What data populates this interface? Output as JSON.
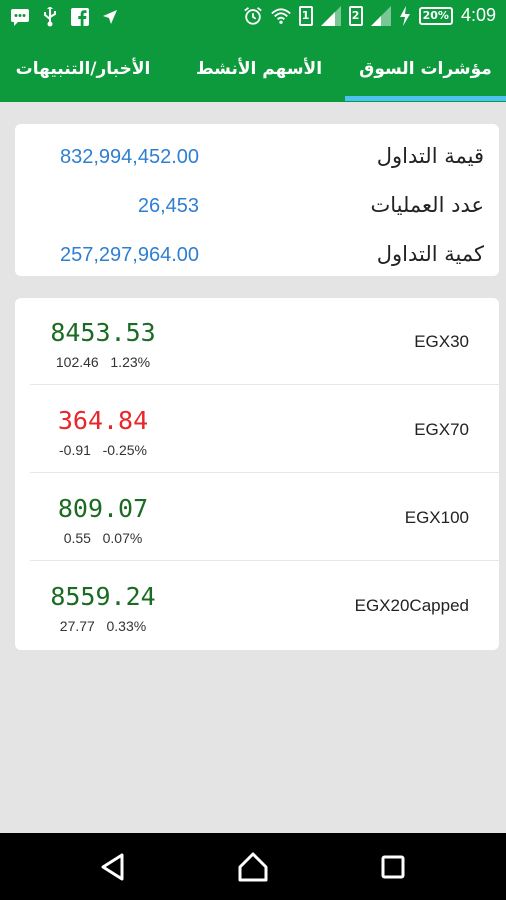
{
  "status_bar": {
    "time": "4:09",
    "battery": "20%",
    "sim1": "1",
    "sim2": "2"
  },
  "tabs": [
    {
      "label": "مؤشرات السوق",
      "active": true
    },
    {
      "label": "الأسهم الأنشط",
      "active": false
    },
    {
      "label": "الأخبار/التنبيهات",
      "active": false
    }
  ],
  "summary": [
    {
      "label": "قيمة التداول",
      "value": "832,994,452.00"
    },
    {
      "label": "عدد العمليات",
      "value": "26,453"
    },
    {
      "label": "كمية التداول",
      "value": "257,297,964.00"
    }
  ],
  "indices": [
    {
      "name": "EGX30",
      "value": "8453.53",
      "change": "102.46",
      "percent": "1.23%",
      "direction": "up"
    },
    {
      "name": "EGX70",
      "value": "364.84",
      "change": "-0.91",
      "percent": "-0.25%",
      "direction": "down"
    },
    {
      "name": "EGX100",
      "value": "809.07",
      "change": "0.55",
      "percent": "0.07%",
      "direction": "up"
    },
    {
      "name": "EGX20Capped",
      "value": "8559.24",
      "change": "27.77",
      "percent": "0.33%",
      "direction": "up"
    }
  ],
  "colors": {
    "header_green": "#0c9a3c",
    "tab_indicator": "#4cc3f2",
    "value_blue": "#2f7fd0",
    "up_green": "#1c6b22",
    "down_red": "#e8262b"
  },
  "icons": [
    "message-icon",
    "usb-icon",
    "facebook-icon",
    "arrow-icon",
    "alarm-icon",
    "wifi-icon",
    "signal-icon",
    "charging-icon"
  ]
}
